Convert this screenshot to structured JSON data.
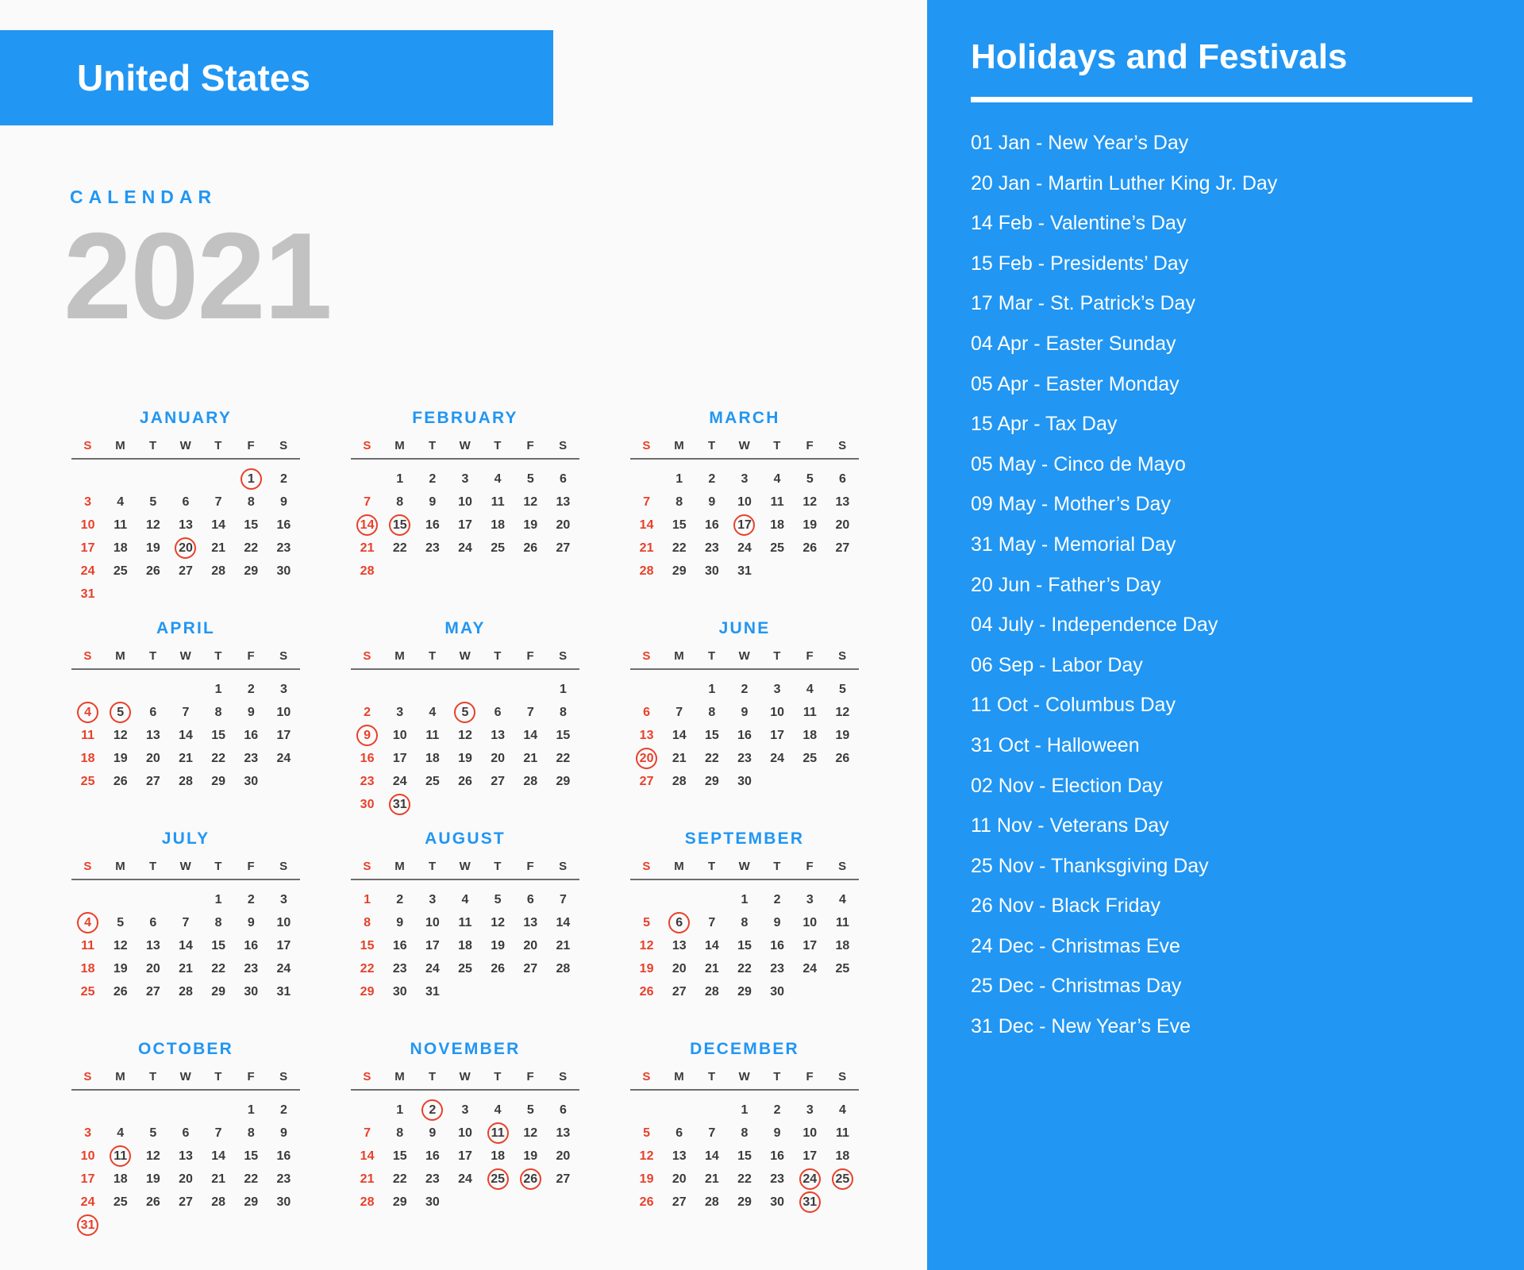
{
  "header": {
    "country": "United States",
    "calendar_word": "CALENDAR",
    "year": "2021"
  },
  "colors": {
    "accent_blue": "#2196f3",
    "highlight_red": "#e8402a",
    "year_gray": "#c2c2c2",
    "day_dark": "#3b3b3b",
    "background": "#fafafa"
  },
  "weekday_headers": [
    "S",
    "M",
    "T",
    "W",
    "T",
    "F",
    "S"
  ],
  "months": [
    {
      "name": "JANUARY",
      "lead_blanks": 5,
      "days": 31,
      "circled": [
        1,
        20
      ]
    },
    {
      "name": "FEBRUARY",
      "lead_blanks": 1,
      "days": 28,
      "circled": [
        14,
        15
      ]
    },
    {
      "name": "MARCH",
      "lead_blanks": 1,
      "days": 31,
      "circled": [
        17
      ]
    },
    {
      "name": "APRIL",
      "lead_blanks": 4,
      "days": 30,
      "circled": [
        4,
        5
      ]
    },
    {
      "name": "MAY",
      "lead_blanks": 6,
      "days": 31,
      "circled": [
        5,
        9,
        31
      ]
    },
    {
      "name": "JUNE",
      "lead_blanks": 2,
      "days": 30,
      "circled": [
        20
      ]
    },
    {
      "name": "JULY",
      "lead_blanks": 4,
      "days": 31,
      "circled": [
        4
      ]
    },
    {
      "name": "AUGUST",
      "lead_blanks": 0,
      "days": 31,
      "circled": []
    },
    {
      "name": "SEPTEMBER",
      "lead_blanks": 3,
      "days": 30,
      "circled": [
        6
      ]
    },
    {
      "name": "OCTOBER",
      "lead_blanks": 5,
      "days": 31,
      "circled": [
        11,
        31
      ]
    },
    {
      "name": "NOVEMBER",
      "lead_blanks": 1,
      "days": 30,
      "circled": [
        2,
        11,
        25,
        26
      ]
    },
    {
      "name": "DECEMBER",
      "lead_blanks": 3,
      "days": 31,
      "circled": [
        24,
        25,
        31
      ]
    }
  ],
  "holidays_panel": {
    "title": "Holidays and Festivals",
    "items": [
      "01 Jan - New Year’s Day",
      "20 Jan - Martin Luther King Jr. Day",
      "14 Feb - Valentine’s Day",
      "15 Feb - Presidents’ Day",
      "17 Mar - St. Patrick’s Day",
      "04 Apr - Easter Sunday",
      "05 Apr - Easter Monday",
      "15 Apr - Tax Day",
      "05 May - Cinco de Mayo",
      "09 May - Mother’s Day",
      "31 May - Memorial Day",
      "20 Jun - Father’s Day",
      "04 July - Independence Day",
      "06 Sep - Labor Day",
      "11 Oct - Columbus Day",
      "31 Oct - Halloween",
      "02 Nov - Election Day",
      "11 Nov - Veterans Day",
      "25 Nov - Thanksgiving Day",
      "26 Nov - Black Friday",
      "24 Dec - Christmas Eve",
      "25 Dec - Christmas Day",
      "31 Dec - New Year’s Eve"
    ]
  }
}
